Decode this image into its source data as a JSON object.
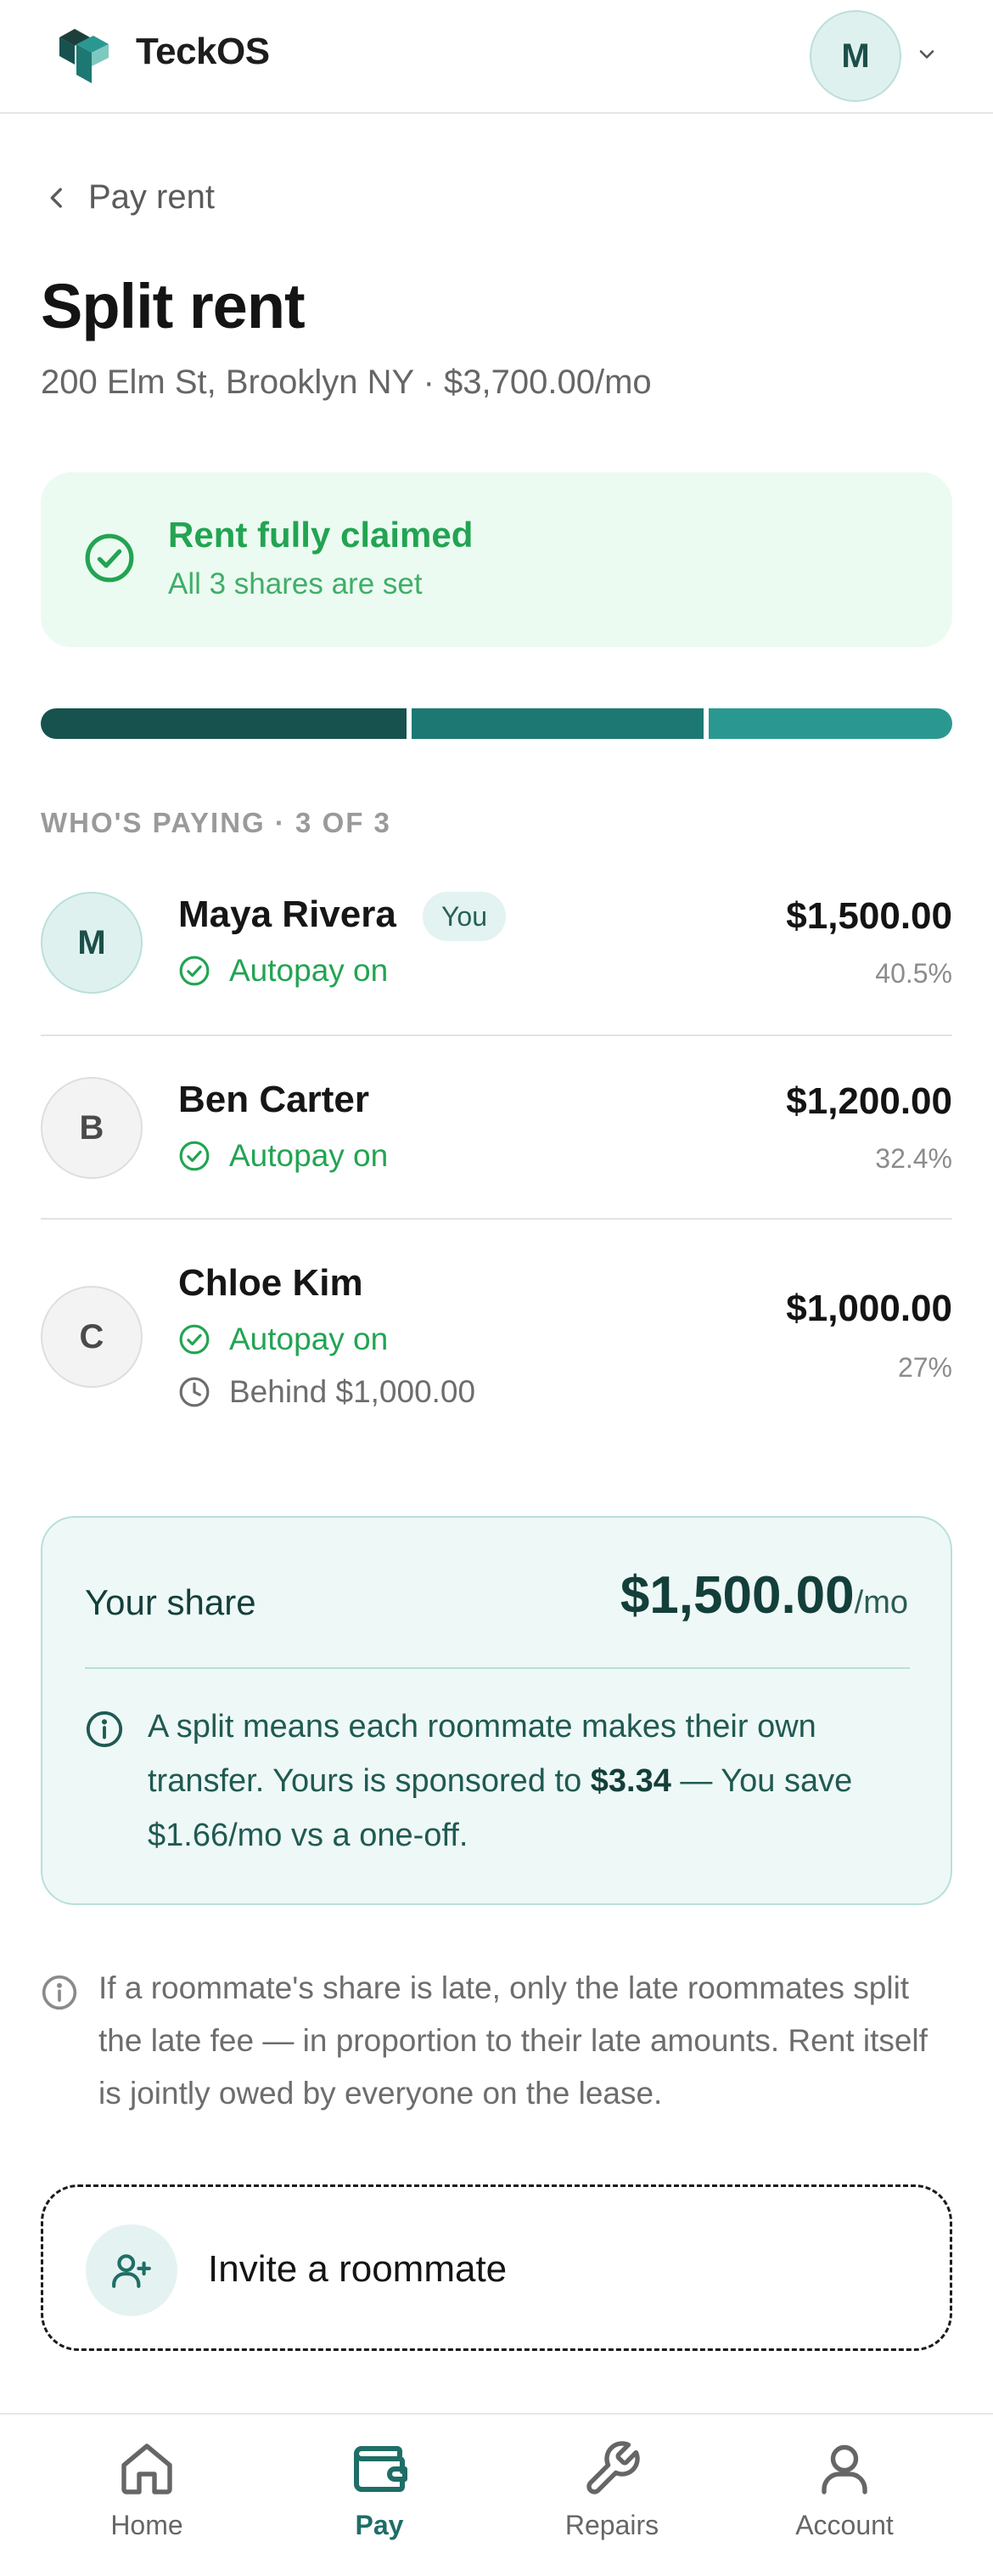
{
  "app": {
    "brand": "TeckOS",
    "user_initial": "M"
  },
  "back_label": "Pay rent",
  "page": {
    "title": "Split rent",
    "subtitle": "200 Elm St, Brooklyn NY · $3,700.00/mo"
  },
  "banner": {
    "title": "Rent fully claimed",
    "subtitle": "All 3 shares are set"
  },
  "progress": {
    "segments": [
      {
        "share": 0.405,
        "color": "#17524f"
      },
      {
        "share": 0.324,
        "color": "#1d7873"
      },
      {
        "share": 0.27,
        "color": "#2a9891"
      }
    ]
  },
  "section_label": "WHO'S PAYING · 3 OF 3",
  "payers": [
    {
      "initial": "M",
      "name": "Maya Rivera",
      "badge": "You",
      "status": "Autopay on",
      "amount": "$1,500.00",
      "pct": "40.5%"
    },
    {
      "initial": "B",
      "name": "Ben Carter",
      "status": "Autopay on",
      "amount": "$1,200.00",
      "pct": "32.4%"
    },
    {
      "initial": "C",
      "name": "Chloe Kim",
      "status": "Autopay on",
      "behind": "Behind $1,000.00",
      "amount": "$1,000.00",
      "pct": "27%"
    }
  ],
  "share": {
    "label": "Your share",
    "amount": "$1,500.00",
    "period": "/mo",
    "info_prefix": "A split means each roommate makes their own transfer. Yours is sponsored to ",
    "info_bold": "$3.34",
    "info_suffix": " — You save $1.66/mo vs a one-off."
  },
  "late_note": "If a roommate's share is late, only the late roommates split the late fee — in proportion to their late amounts. Rent itself is jointly owed by everyone on the lease.",
  "invite_label": "Invite a roommate",
  "nav": {
    "home": "Home",
    "pay": "Pay",
    "repairs": "Repairs",
    "account": "Account"
  },
  "colors": {
    "accent": "#1f6e67",
    "success": "#22a452",
    "banner_bg": "#ecfbf1",
    "share_bg": "#eef8f7"
  }
}
